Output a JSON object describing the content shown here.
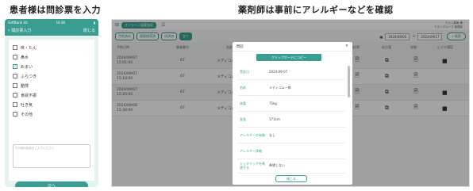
{
  "captions": {
    "left": "患者様は問診票を入力",
    "right": "薬剤師は事前にアレルギーなどを確認"
  },
  "phone": {
    "status_left": "SoftBank 4G",
    "status_time": "16:36",
    "header_title": "問診票入力",
    "header_close": "閉じる",
    "items": [
      {
        "label": "咳・たん",
        "checked": false
      },
      {
        "label": "鼻水",
        "checked": false
      },
      {
        "label": "めまい",
        "checked": true
      },
      {
        "label": "ふらつき",
        "checked": false
      },
      {
        "label": "動悸",
        "checked": false
      },
      {
        "label": "食欲不振",
        "checked": false
      },
      {
        "label": "吐き気",
        "checked": false
      },
      {
        "label": "その他",
        "checked": false
      }
    ],
    "textarea_placeholder": "その他の症状をご入力ください",
    "next_label": "次へ"
  },
  "desktop": {
    "badge": "オンライン服薬指導",
    "user_line1": "テスト薬局 様",
    "user_line2": "テストグループ 管理者",
    "filters": [
      "予約済み",
      "服薬指導済",
      "決済済",
      "全て"
    ],
    "date_from": "2024/09/03",
    "date_to": "2024/09/17",
    "search_label": "検索",
    "columns": [
      "予約日時",
      "患者番号",
      "名前",
      "問診票",
      "処方箋",
      "詳細",
      "ビデオ通話"
    ],
    "rows": [
      {
        "date": "2024/09/07",
        "time": "15:01:00",
        "id": "67",
        "name": "メディコム一郎",
        "video": true
      },
      {
        "date": "2024/09/07",
        "time": "15:10:00",
        "id": "67",
        "name": "メディコム一郎",
        "video": false
      },
      {
        "date": "2024/09/07",
        "time": "15:20:00",
        "id": "67",
        "name": "メディコム一郎",
        "video": true
      },
      {
        "date": "2024/09/08",
        "time": "15:30:00",
        "id": "67",
        "name": "メディコム一郎",
        "video": true
      }
    ]
  },
  "modal": {
    "title": "問診",
    "copy_label": "クリップボードにコピー",
    "fields": [
      {
        "label": "受診日",
        "value": "2024-09-07"
      },
      {
        "label": "名前",
        "value": "メディコム一郎"
      },
      {
        "label": "体重",
        "value": "75kg"
      },
      {
        "label": "身長",
        "value": "173cm"
      },
      {
        "label": "アレルギーの有無",
        "value": "なし"
      },
      {
        "label": "アレルギー詳細",
        "value": ""
      },
      {
        "label": "ジェネリックを希望する",
        "value": "希望しない"
      }
    ],
    "close_label": "閉じる"
  }
}
